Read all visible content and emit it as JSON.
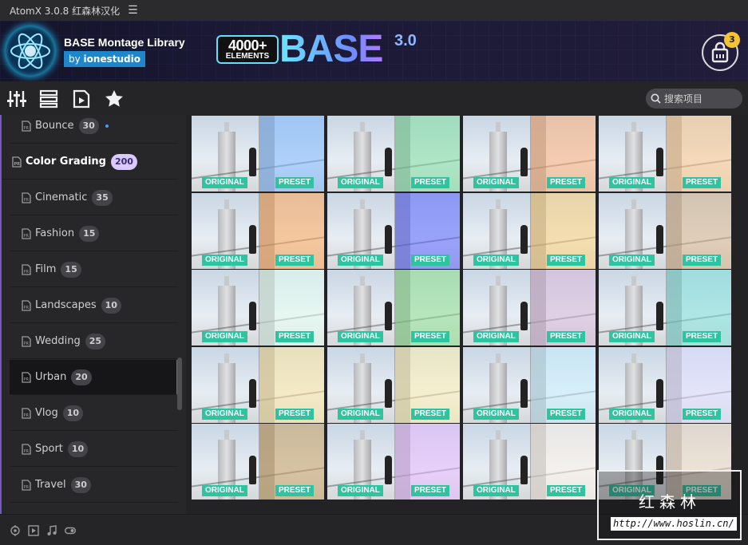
{
  "window": {
    "title": "AtomX 3.0.8 红森林汉化",
    "menu_icon": "hamburger-icon"
  },
  "header": {
    "library_title": "BASE Montage Library",
    "by_prefix": "by",
    "by_author": "ionestudio",
    "banner_count": "4000+",
    "banner_elements": "ELEMENTS",
    "banner_word": "BASE",
    "banner_version": "3.0",
    "cart_count": "3"
  },
  "toolbar": {
    "icons": [
      "sliders-icon",
      "list-view-icon",
      "video-file-icon",
      "star-icon"
    ],
    "search_placeholder": "搜索项目"
  },
  "sidebar": {
    "items": [
      {
        "label": "Bounce",
        "count": "30",
        "type": "sub"
      },
      {
        "label": "Color Grading",
        "count": "200",
        "type": "category"
      },
      {
        "label": "Cinematic",
        "count": "35",
        "type": "sub"
      },
      {
        "label": "Fashion",
        "count": "15",
        "type": "sub"
      },
      {
        "label": "Film",
        "count": "15",
        "type": "sub"
      },
      {
        "label": "Landscapes",
        "count": "10",
        "type": "sub"
      },
      {
        "label": "Wedding",
        "count": "25",
        "type": "sub"
      },
      {
        "label": "Urban",
        "count": "20",
        "type": "sub",
        "selected": true
      },
      {
        "label": "Vlog",
        "count": "10",
        "type": "sub"
      },
      {
        "label": "Sport",
        "count": "10",
        "type": "sub"
      },
      {
        "label": "Travel",
        "count": "30",
        "type": "sub"
      }
    ]
  },
  "grid": {
    "original_label": "ORIGINAL",
    "preset_label": "PRESET",
    "tints": [
      "#7fb8ff",
      "#7fe0a0",
      "#ffb07a",
      "#ffc98a",
      "#ffa85a",
      "#5a66ff",
      "#ffd27a",
      "#d8b48a",
      "#e6fff0",
      "#8ee08e",
      "#d8b8d8",
      "#7fe0d8",
      "#ffe7a0",
      "#fff0b0",
      "#c8f0ff",
      "#e0dcff",
      "#c8a060",
      "#e8b8ff",
      "#fff4e8",
      "#f0d8c0"
    ]
  },
  "bottombar": {
    "icons": [
      "target-icon",
      "video-icon",
      "music-icon",
      "toggle-icon"
    ]
  },
  "watermark": {
    "text_cn": "红森林",
    "url": "http://www.hoslin.cn/"
  },
  "colors": {
    "accent": "#7a55c6",
    "label_green": "#2ec4a0",
    "cart_badge": "#f4c430",
    "by_badge": "#1e86c9"
  }
}
